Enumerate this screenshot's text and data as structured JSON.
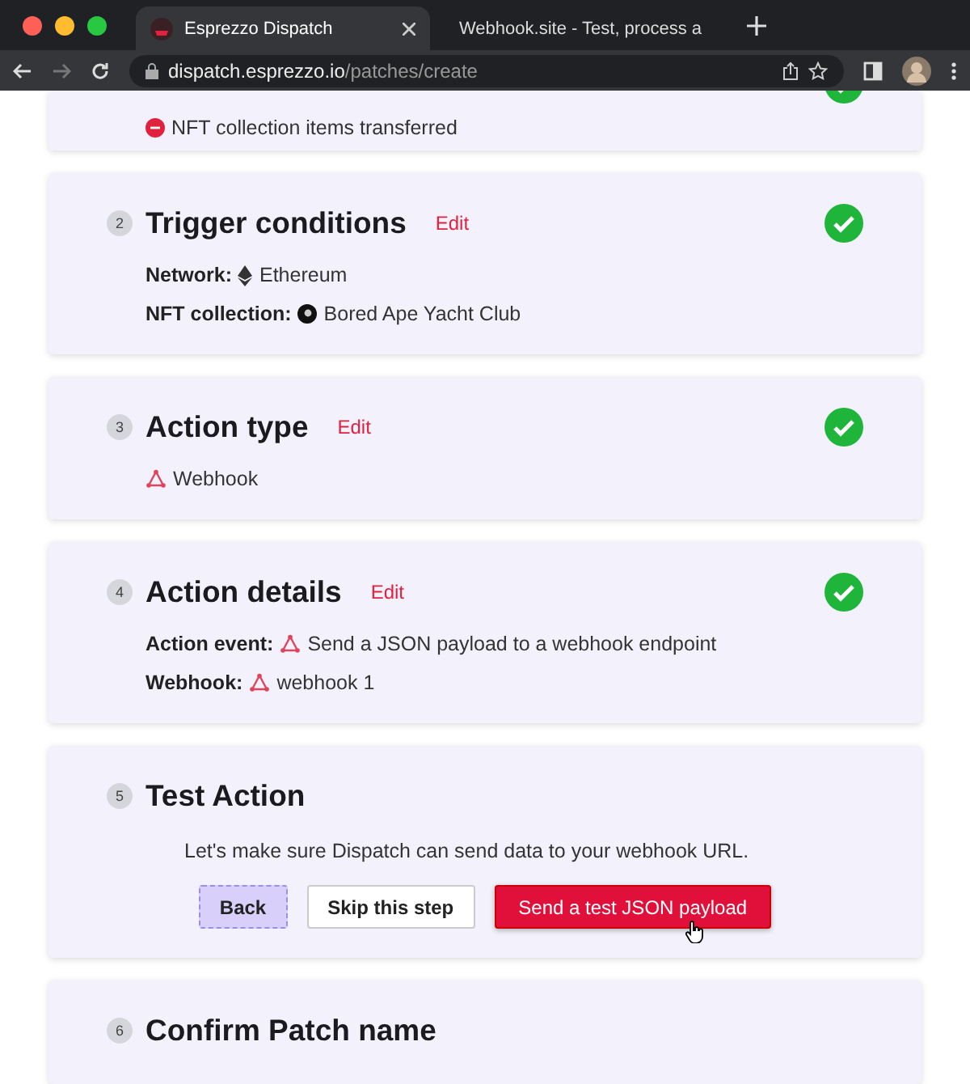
{
  "browser": {
    "tabs": [
      {
        "title": "Esprezzo Dispatch",
        "selected": true
      },
      {
        "title": "Webhook.site - Test, process a",
        "selected": false
      }
    ],
    "url": {
      "host": "dispatch.esprezzo.io",
      "path": "/patches/create"
    }
  },
  "steps": [
    {
      "completed": true,
      "details": [
        {
          "kind": "nft",
          "value": "NFT collection items transferred"
        }
      ]
    },
    {
      "number": "2",
      "title": "Trigger conditions",
      "edit": "Edit",
      "completed": true,
      "details": [
        {
          "label": "Network:",
          "kind": "ethereum",
          "value": "Ethereum"
        },
        {
          "label": "NFT collection:",
          "kind": "collection",
          "value": "Bored Ape Yacht Club"
        }
      ]
    },
    {
      "number": "3",
      "title": "Action type",
      "edit": "Edit",
      "completed": true,
      "details": [
        {
          "kind": "webhook",
          "value": "Webhook"
        }
      ]
    },
    {
      "number": "4",
      "title": "Action details",
      "edit": "Edit",
      "completed": true,
      "details": [
        {
          "label": "Action event:",
          "kind": "webhook",
          "value": "Send a JSON payload to a webhook endpoint"
        },
        {
          "label": "Webhook:",
          "kind": "webhook",
          "value": "webhook 1"
        }
      ]
    },
    {
      "number": "5",
      "title": "Test Action",
      "description": "Let's make sure Dispatch can send data to your webhook URL.",
      "buttons": [
        {
          "label": "Back",
          "kind": "secondary"
        },
        {
          "label": "Skip this step",
          "kind": "outline"
        },
        {
          "label": "Send a test JSON payload",
          "kind": "primary",
          "hovered": true
        }
      ]
    },
    {
      "number": "6",
      "title": "Confirm Patch name"
    }
  ]
}
